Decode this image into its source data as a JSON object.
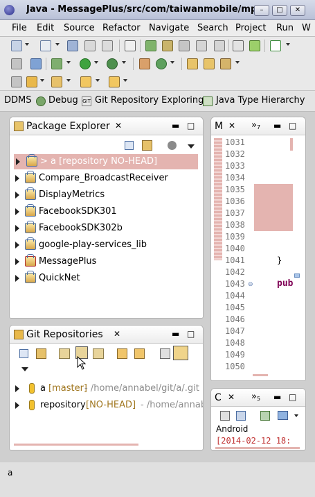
{
  "window": {
    "title": "Java - MessagePlus/src/com/taiwanmobile/mplus",
    "minimize": "–",
    "maximize": "□",
    "close": "✕"
  },
  "menu": [
    "File",
    "Edit",
    "Source",
    "Refactor",
    "Navigate",
    "Search",
    "Project",
    "Run",
    "W"
  ],
  "perspectives": [
    "DDMS",
    "Debug",
    "Git Repository Exploring",
    "Java Type Hierarchy"
  ],
  "package_explorer": {
    "title": "Package Explorer",
    "items": [
      {
        "label": "> a [repository NO-HEAD]",
        "selected": true
      },
      {
        "label": "Compare_BroadcastReceiver"
      },
      {
        "label": "DisplayMetrics"
      },
      {
        "label": "FacebookSDK301"
      },
      {
        "label": "FacebookSDK302b"
      },
      {
        "label": "google-play-services_lib"
      },
      {
        "label": "MessagePlus"
      },
      {
        "label": "QuickNet"
      }
    ]
  },
  "editor": {
    "tab_label": "M",
    "overflow": "»",
    "overflow_count": "7",
    "lines": [
      "1031",
      "1032",
      "1033",
      "1034",
      "1035",
      "1036",
      "1037",
      "1038",
      "1039",
      "1040",
      "1041",
      "1042",
      "1043",
      "1044",
      "1045",
      "1046",
      "1047",
      "1048",
      "1049",
      "1050"
    ],
    "brace": "}",
    "keyword": "pub"
  },
  "git_repositories": {
    "title": "Git Repositories",
    "repos": [
      {
        "name": "a",
        "branch": "[master]",
        "path": "- /home/annabel/git/a/.git"
      },
      {
        "name": "repository",
        "branch": "[NO-HEAD]",
        "path": "- /home/annabe"
      }
    ]
  },
  "console": {
    "tab_label": "C",
    "overflow": "»",
    "overflow_count": "5",
    "heading": "Android",
    "line": "[2014-02-12 18:"
  },
  "status": {
    "text": "a"
  },
  "colors": {
    "selection": "#e4b4b0",
    "branch": "#a0761e",
    "path": "#8c8c8c",
    "console_text": "#c03030",
    "keyword": "#7f0055"
  }
}
